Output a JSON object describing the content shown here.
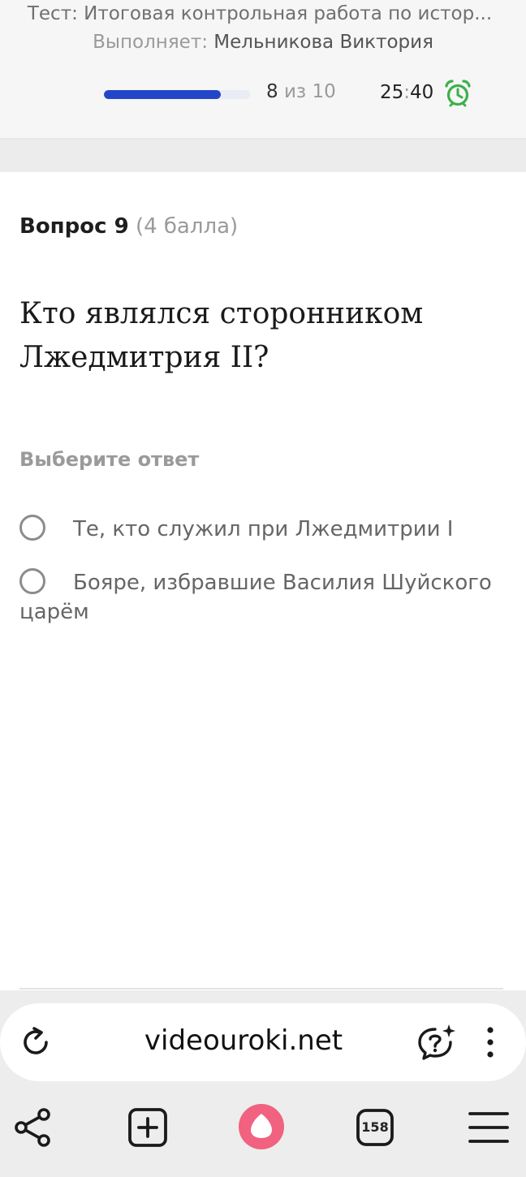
{
  "test": {
    "title": "Тест: Итоговая контрольная работа по истор...",
    "performer_label": "Выполняет:",
    "performer_name": "Мельникова Виктория",
    "progress_current": "8",
    "progress_sep": "из",
    "progress_total": "10",
    "progress_fraction": 0.8,
    "timer_minutes": "25",
    "timer_colon": ":",
    "timer_seconds": "40"
  },
  "question": {
    "number_label": "Вопрос 9",
    "points": "(4 балла)",
    "text": "Кто являлся сторонником Лжедмитрия II?",
    "choose_label": "Выберите ответ",
    "options": [
      {
        "label": "Те, кто служил при Лжедмитрии I",
        "selected": false
      },
      {
        "label": "Бояре, избравшие Василия Шуйского царём",
        "selected": false
      }
    ]
  },
  "browser": {
    "url": "videouroki.net",
    "tabs_count": "158",
    "accent_color": "#f0627f",
    "icons": [
      "reload-icon",
      "chat-question-icon",
      "menu-dots-icon",
      "share-icon",
      "new-tab-icon",
      "alice-icon",
      "tabs-icon",
      "hamburger-icon"
    ]
  },
  "colors": {
    "progress": "#2346c9",
    "alarm": "#3db04b"
  }
}
